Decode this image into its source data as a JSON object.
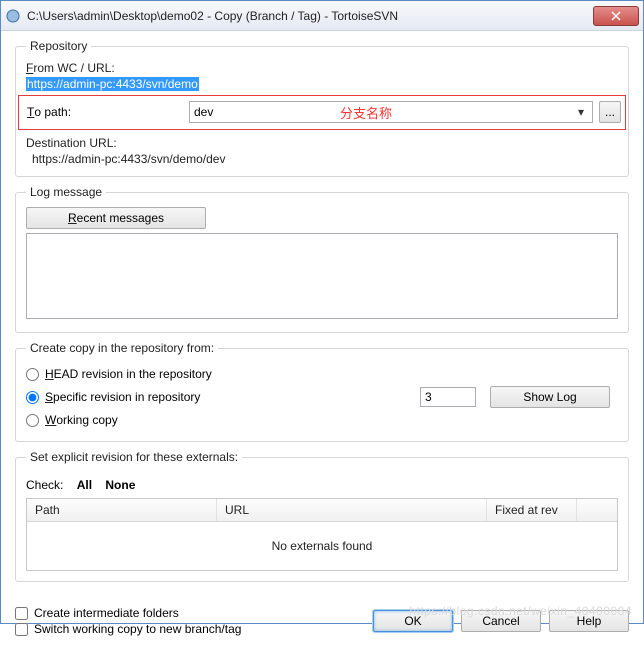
{
  "window": {
    "title": "C:\\Users\\admin\\Desktop\\demo02 - Copy (Branch / Tag) - TortoiseSVN"
  },
  "repository": {
    "legend": "Repository",
    "from_label": "From WC / URL:",
    "from_url": "https://admin-pc:4433/svn/demo",
    "to_label": "To path:",
    "to_value": "dev",
    "annotation": "分支名称",
    "browse": "...",
    "dest_label": "Destination URL:",
    "dest_url": "https://admin-pc:4433/svn/demo/dev"
  },
  "logmsg": {
    "legend": "Log message",
    "recent": "Recent messages",
    "value": ""
  },
  "copyfrom": {
    "legend": "Create copy in the repository from:",
    "head": "HEAD revision in the repository",
    "specific": "Specific revision in repository",
    "working": "Working copy",
    "rev_value": "3",
    "showlog": "Show Log"
  },
  "externals": {
    "legend": "Set explicit revision for these externals:",
    "check_label": "Check:",
    "all": "All",
    "none": "None",
    "col_path": "Path",
    "col_url": "URL",
    "col_fixed": "Fixed at rev",
    "empty": "No externals found"
  },
  "checks": {
    "intermediate": "Create intermediate folders",
    "switch": "Switch working copy to new branch/tag"
  },
  "buttons": {
    "ok": "OK",
    "cancel": "Cancel",
    "help": "Help"
  },
  "watermark": "https://blog.csdn.net/weixin_40400084"
}
